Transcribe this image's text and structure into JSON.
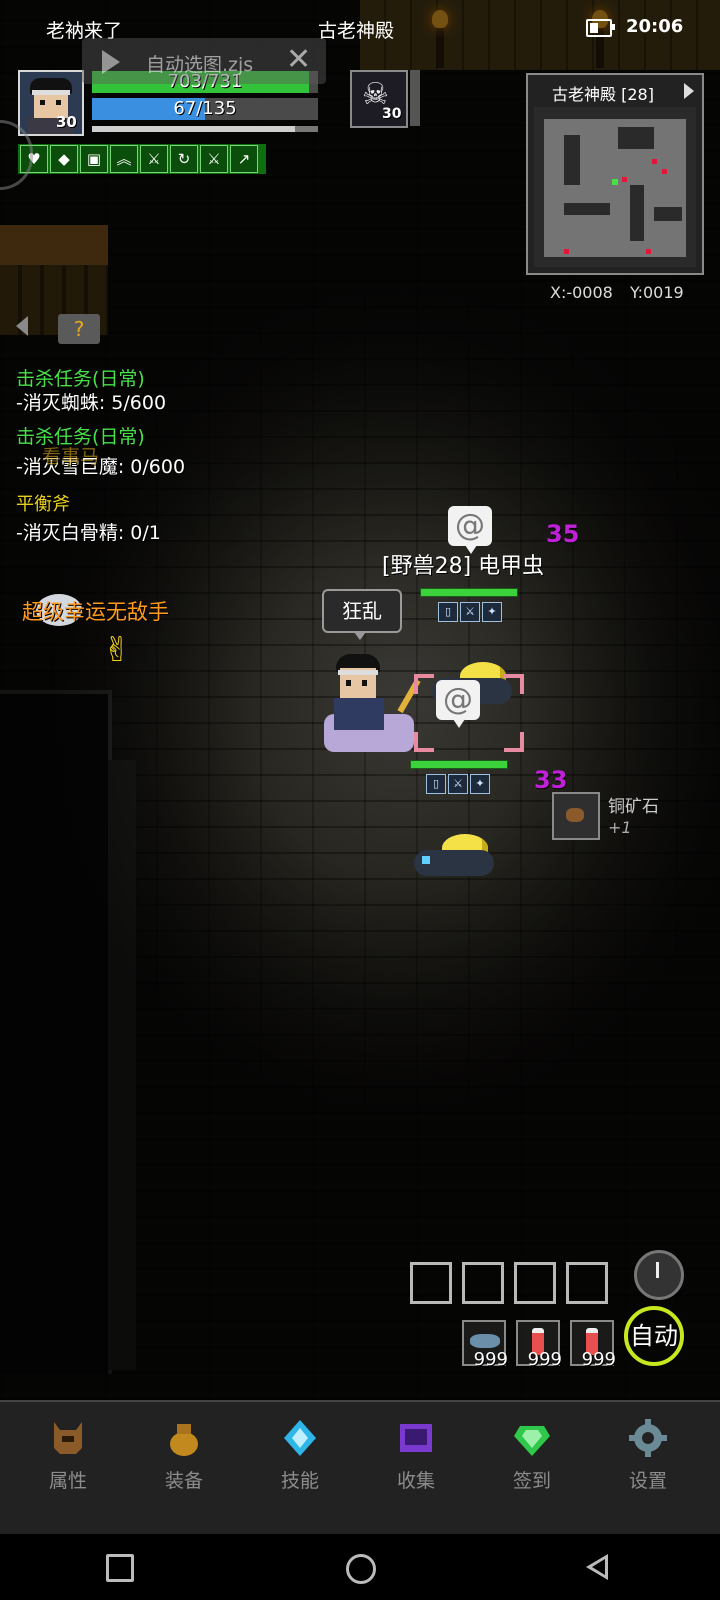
{
  "status_bar": {
    "app_label": "老衲来了",
    "location_title": "古老神殿",
    "time": "20:06"
  },
  "script_overlay": {
    "script_name": "自动选图.zjs"
  },
  "player": {
    "level": "30",
    "hp_text": "703/731",
    "hp_fraction": 0.96,
    "mp_text": "67/135",
    "mp_fraction": 0.5,
    "xp_fraction": 0.9,
    "buff_icons": [
      "heart-icon",
      "shield-gem-icon",
      "armor-icon",
      "chevron-up-icon",
      "sword-icon",
      "cycle-icon",
      "sword-icon",
      "boot-icon"
    ]
  },
  "target": {
    "level": "30",
    "icon": "skull-icon"
  },
  "minimap": {
    "title": "古老神殿 [28]",
    "x_coord": "X:-0008",
    "y_coord": "Y:0019"
  },
  "quests": [
    {
      "text": "击杀任务(日常)",
      "color": "green"
    },
    {
      "text": "-消灭蜘蛛: 5/600",
      "color": "white"
    },
    {
      "text": "击杀任务(日常)",
      "color": "green"
    },
    {
      "text": "-消灭雪巨魔: 0/600",
      "color": "white"
    },
    {
      "text": "平衡斧",
      "color": "yellow"
    },
    {
      "text": "-消灭白骨精: 0/1",
      "color": "white"
    }
  ],
  "overlap_text": "看事马",
  "lucky_title": "超级幸运无敌手",
  "speech_bubble": "狂乱",
  "monster": {
    "label": "[野兽28] 电甲虫",
    "damage_numbers": [
      "35",
      "33"
    ]
  },
  "loot": {
    "name": "铜矿石",
    "qty": "+1"
  },
  "potions": [
    {
      "icon": "fish-icon",
      "count": "999"
    },
    {
      "icon": "red-potion-icon",
      "count": "999"
    },
    {
      "icon": "red-potion-icon",
      "count": "999"
    }
  ],
  "auto_label": "自动",
  "nav": [
    {
      "label": "属性",
      "icon": "helmet-icon",
      "color": "#8a5a28"
    },
    {
      "label": "装备",
      "icon": "bag-icon",
      "color": "#c28a1e"
    },
    {
      "label": "技能",
      "icon": "crystal-icon",
      "color": "#2fb6e8"
    },
    {
      "label": "收集",
      "icon": "book-icon",
      "color": "#7a3ad0"
    },
    {
      "label": "签到",
      "icon": "gem-icon",
      "color": "#2fc84a"
    },
    {
      "label": "设置",
      "icon": "gear-icon",
      "color": "#6a8a96"
    }
  ]
}
